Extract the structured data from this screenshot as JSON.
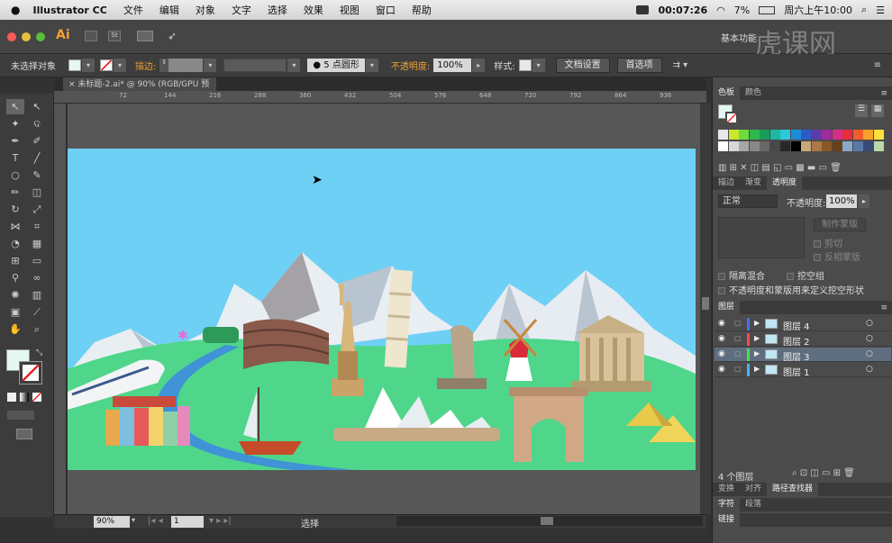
{
  "menubar": {
    "app": "Illustrator CC",
    "items": [
      "文件",
      "编辑",
      "对象",
      "文字",
      "选择",
      "效果",
      "视图",
      "窗口",
      "帮助"
    ],
    "time": "00:07:26",
    "battery": "7%",
    "clock": "周六上午10:00"
  },
  "titlebar": {
    "logo": "Ai",
    "workspace": "基本功能",
    "watermark": "虎课网"
  },
  "control": {
    "selection": "未选择对象",
    "stroke_label": "描边:",
    "brush": "5 点圆形",
    "opacity_label": "不透明度:",
    "opacity_value": "100%",
    "style_label": "样式:",
    "doc_setup": "文档设置",
    "prefs": "首选项"
  },
  "document": {
    "tab_title": "未标题-2.ai* @ 90% (RGB/GPU 预览)",
    "ruler_marks": [
      "72",
      "144",
      "216",
      "288",
      "360",
      "432",
      "504",
      "576",
      "648",
      "720",
      "792",
      "864",
      "936"
    ]
  },
  "status": {
    "zoom": "90%",
    "page": "1",
    "tool": "选择"
  },
  "panels": {
    "swatches_tabs": [
      "色板",
      "颜色"
    ],
    "transparency_tabs": [
      "描边",
      "渐变",
      "透明度"
    ],
    "blend_mode": "正常",
    "opacity_label": "不透明度:",
    "opacity_value": "100%",
    "make_mask": "制作蒙版",
    "clip": "剪切",
    "invert_mask": "反相蒙版",
    "isolate_blend": "隔离混合",
    "knockout_group": "挖空组",
    "opacity_mask_text": "不透明度和蒙版用来定义挖空形状",
    "layers_title": "图层",
    "layers": [
      {
        "name": "图层 4",
        "color": "#4c6cff"
      },
      {
        "name": "图层 2",
        "color": "#ff4a4a"
      },
      {
        "name": "图层 3",
        "color": "#4cdc4c"
      },
      {
        "name": "图层 1",
        "color": "#4ab0ff"
      }
    ],
    "layer_count": "4 个图层",
    "bottom_tabs1": [
      "变换",
      "对齐",
      "路径查找器"
    ],
    "bottom_tabs2": [
      "字符",
      "段落"
    ],
    "bottom_tabs3": [
      "链接"
    ]
  },
  "colors": {
    "sky": "#6fd0f5",
    "ground": "#4fd68a",
    "river": "#3f93d6",
    "accent_orange": "#f0a030"
  },
  "swatch_colors": [
    "#e8e8e8",
    "#c8e830",
    "#6edc3c",
    "#2cb84c",
    "#1c9c5c",
    "#1cb8a0",
    "#2cc8e0",
    "#1c8cd8",
    "#2c5cc8",
    "#5c3ca8",
    "#9c2c9c",
    "#d82c8c",
    "#e82c3c",
    "#f05c2c",
    "#f8a02c",
    "#fce03c",
    "#ffffff",
    "#d8d8d8",
    "#a8a8a8",
    "#888888",
    "#686868",
    "#484848",
    "#282828",
    "#000000",
    "#c8a878",
    "#a87848",
    "#885828",
    "#684018",
    "#88a8c8",
    "#5878a8",
    "#384878",
    "#b8d8a8"
  ]
}
